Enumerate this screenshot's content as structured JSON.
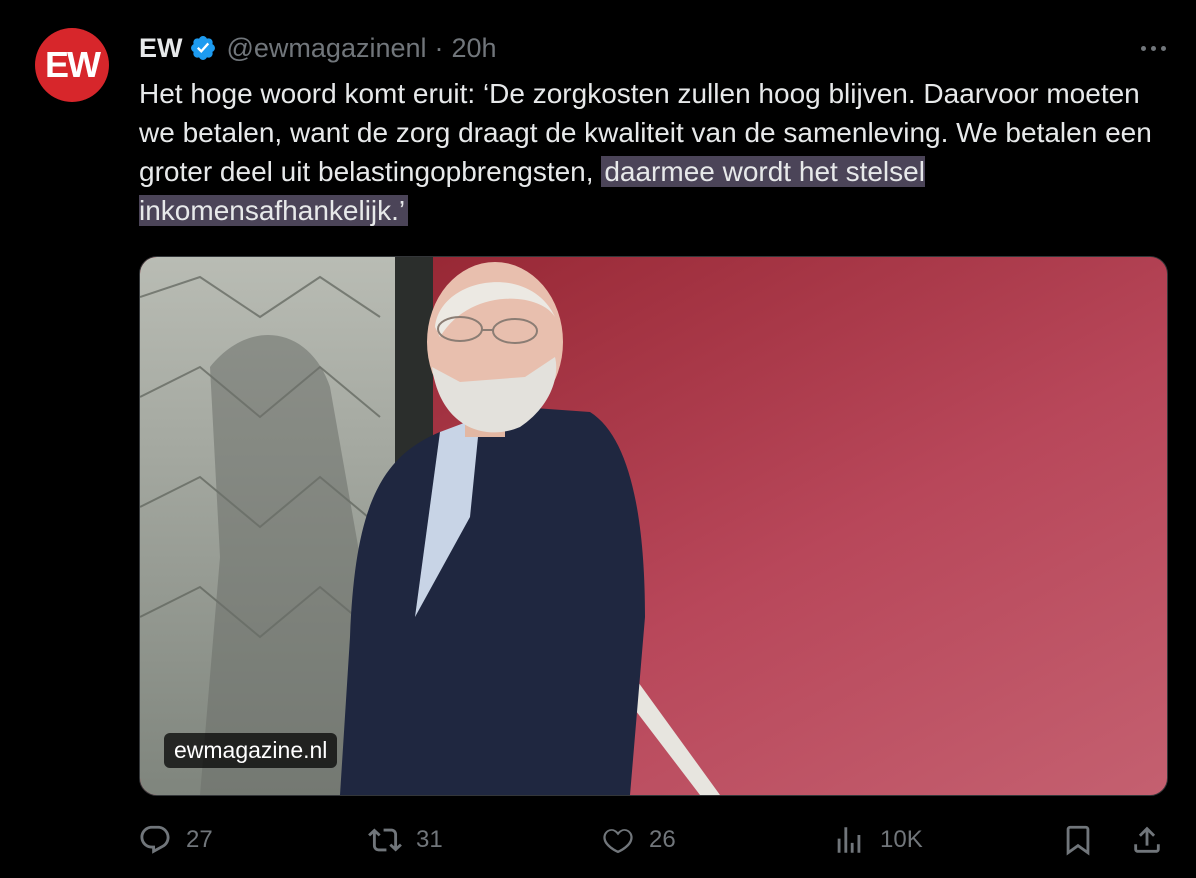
{
  "author": {
    "avatar_text": "EW",
    "avatar_color": "#d7262b",
    "name": "EW",
    "handle": "@ewmagazinenl",
    "separator": "·",
    "time": "20h",
    "verified": true
  },
  "tweet": {
    "text_plain": "Het hoge woord komt eruit: ‘De zorgkosten zullen hoog blijven. Daarvoor moeten we betalen, want de zorg draagt de kwaliteit van de samenleving. We betalen een groter deel uit belastingopbrengsten, ",
    "text_highlighted": "daarmee wordt het stelsel inkomensafhankelijk.’",
    "highlight_color": "#4b4458"
  },
  "media": {
    "link_label": "ewmagazine.nl",
    "background_color": "#9b2b34"
  },
  "actions": {
    "replies": "27",
    "reposts": "31",
    "likes": "26",
    "views": "10K"
  },
  "icons": [
    "verified-badge-icon",
    "more-options-icon",
    "reply-icon",
    "repost-icon",
    "like-icon",
    "views-icon",
    "bookmark-icon",
    "share-icon"
  ]
}
